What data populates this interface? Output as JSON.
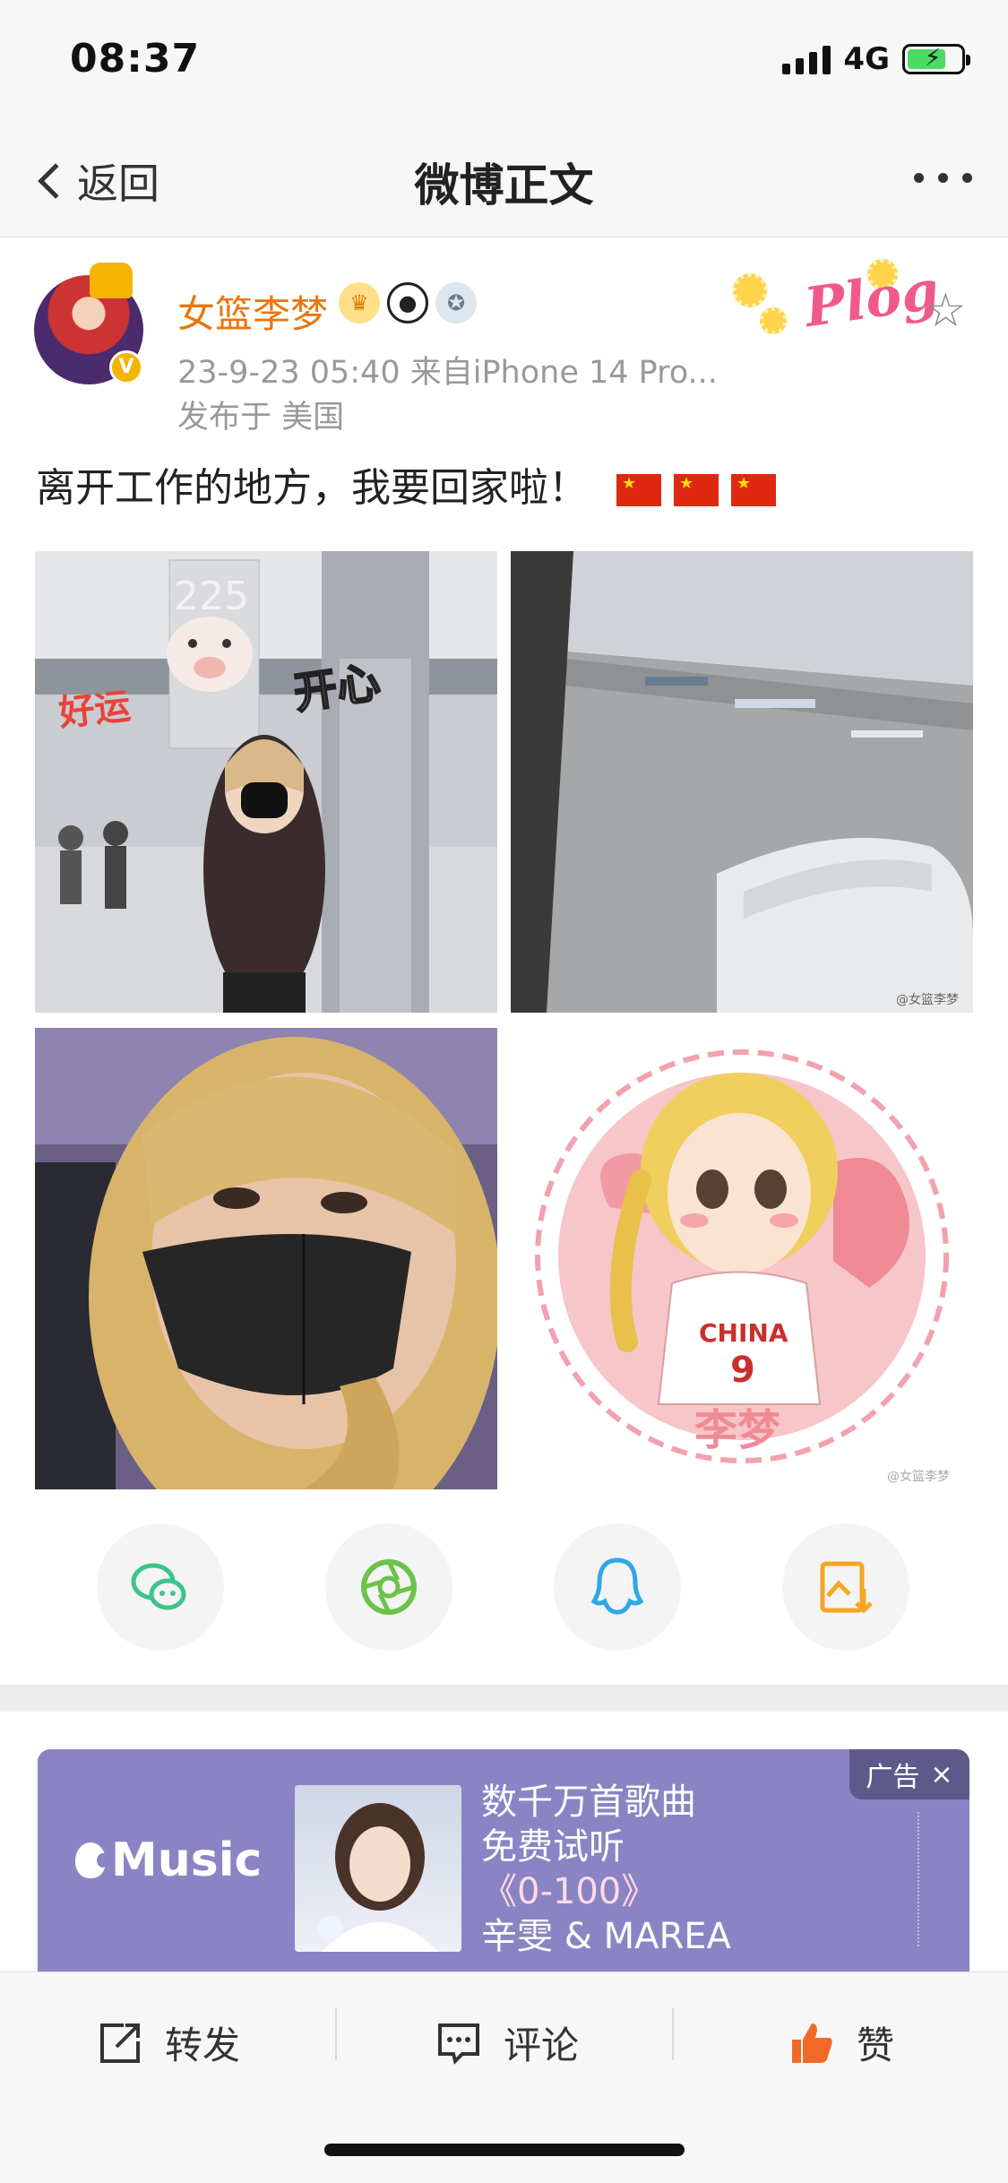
{
  "status_bar": {
    "time": "08:37",
    "network": "4G"
  },
  "nav": {
    "back_label": "返回",
    "title": "微博正文"
  },
  "post": {
    "username": "女篮李梦",
    "time_source": "23-9-23 05:40  来自iPhone 14 Pro...",
    "location": "发布于 美国",
    "text": "离开工作的地方，我要回家啦！",
    "sticker_text": "Plog",
    "photos": [
      {
        "overlay_text": "开心",
        "gate_number": "225",
        "sticker_text": "好运"
      },
      {
        "watermark": "@女篮李梦"
      },
      {},
      {
        "jersey_text": "CHINA",
        "jersey_number": "9",
        "name_text": "李梦",
        "watermark": "@女篮李梦"
      }
    ]
  },
  "share": {
    "icons": [
      "wechat-icon",
      "moments-icon",
      "qq-icon",
      "save-image-icon"
    ]
  },
  "ad": {
    "brand": "Music",
    "line1": "数千万首歌曲",
    "line2": "免费试听",
    "song": "《0-100》",
    "artist": "辛雯 & MAREA",
    "tag": "广告",
    "close_symbol": "×"
  },
  "actions": {
    "repost": "转发",
    "comment": "评论",
    "like": "赞"
  },
  "colors": {
    "username": "#e8760c",
    "ad_bg": "#8a84c4",
    "like_icon": "#f06a26"
  }
}
